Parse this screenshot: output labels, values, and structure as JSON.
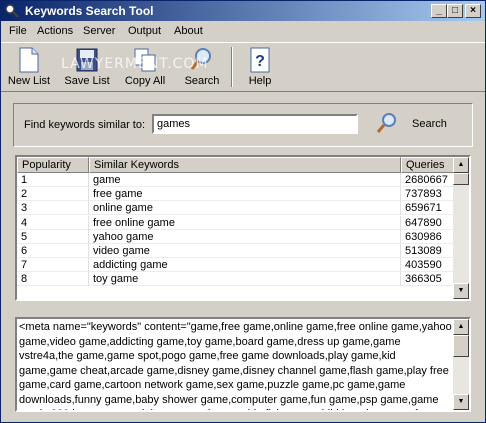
{
  "window": {
    "title": "Keywords Search Tool"
  },
  "title_buttons": {
    "minimize": "_",
    "maximize": "□",
    "close": "×"
  },
  "menu": [
    "File",
    "Actions",
    "Server",
    "Output",
    "About"
  ],
  "toolbar": {
    "new_list": "New List",
    "save_list": "Save List",
    "copy_all": "Copy All",
    "search": "Search",
    "help": "Help"
  },
  "watermark": "LAWYERMENT.COM",
  "find": {
    "label": "Find keywords similar to:",
    "value": "games",
    "button": "Search"
  },
  "table": {
    "headers": [
      "Popularity",
      "Similar Keywords",
      "Queries"
    ],
    "rows": [
      [
        "1",
        "game",
        "2680667"
      ],
      [
        "2",
        "free game",
        "737893"
      ],
      [
        "3",
        "online game",
        "659671"
      ],
      [
        "4",
        "free online game",
        "647890"
      ],
      [
        "5",
        "yahoo game",
        "630986"
      ],
      [
        "6",
        "video game",
        "513089"
      ],
      [
        "7",
        "addicting game",
        "403590"
      ],
      [
        "8",
        "toy game",
        "366305"
      ]
    ]
  },
  "meta_output": "<meta name=\"keywords\" content=\"game,free game,online game,free online game,yahoo game,video game,addicting game,toy game,board game,dress up game,game vstre4a,the game,game spot,pogo game,free game downloads,play game,kid game,game cheat,arcade game,disney game,disney channel game,flash game,play free game,card game,cartoon network game,sex game,puzzle game,pc game,game downloads,funny game,baby shower game,computer game,fun game,psp game,game music,360 box game x,adult game,math game,big fish game,child learning game,free yahoo game,game winner,car game,x box",
  "colors": {
    "title_start": "#0a246a",
    "title_end": "#a6caf0",
    "face": "#d4d0c8"
  }
}
